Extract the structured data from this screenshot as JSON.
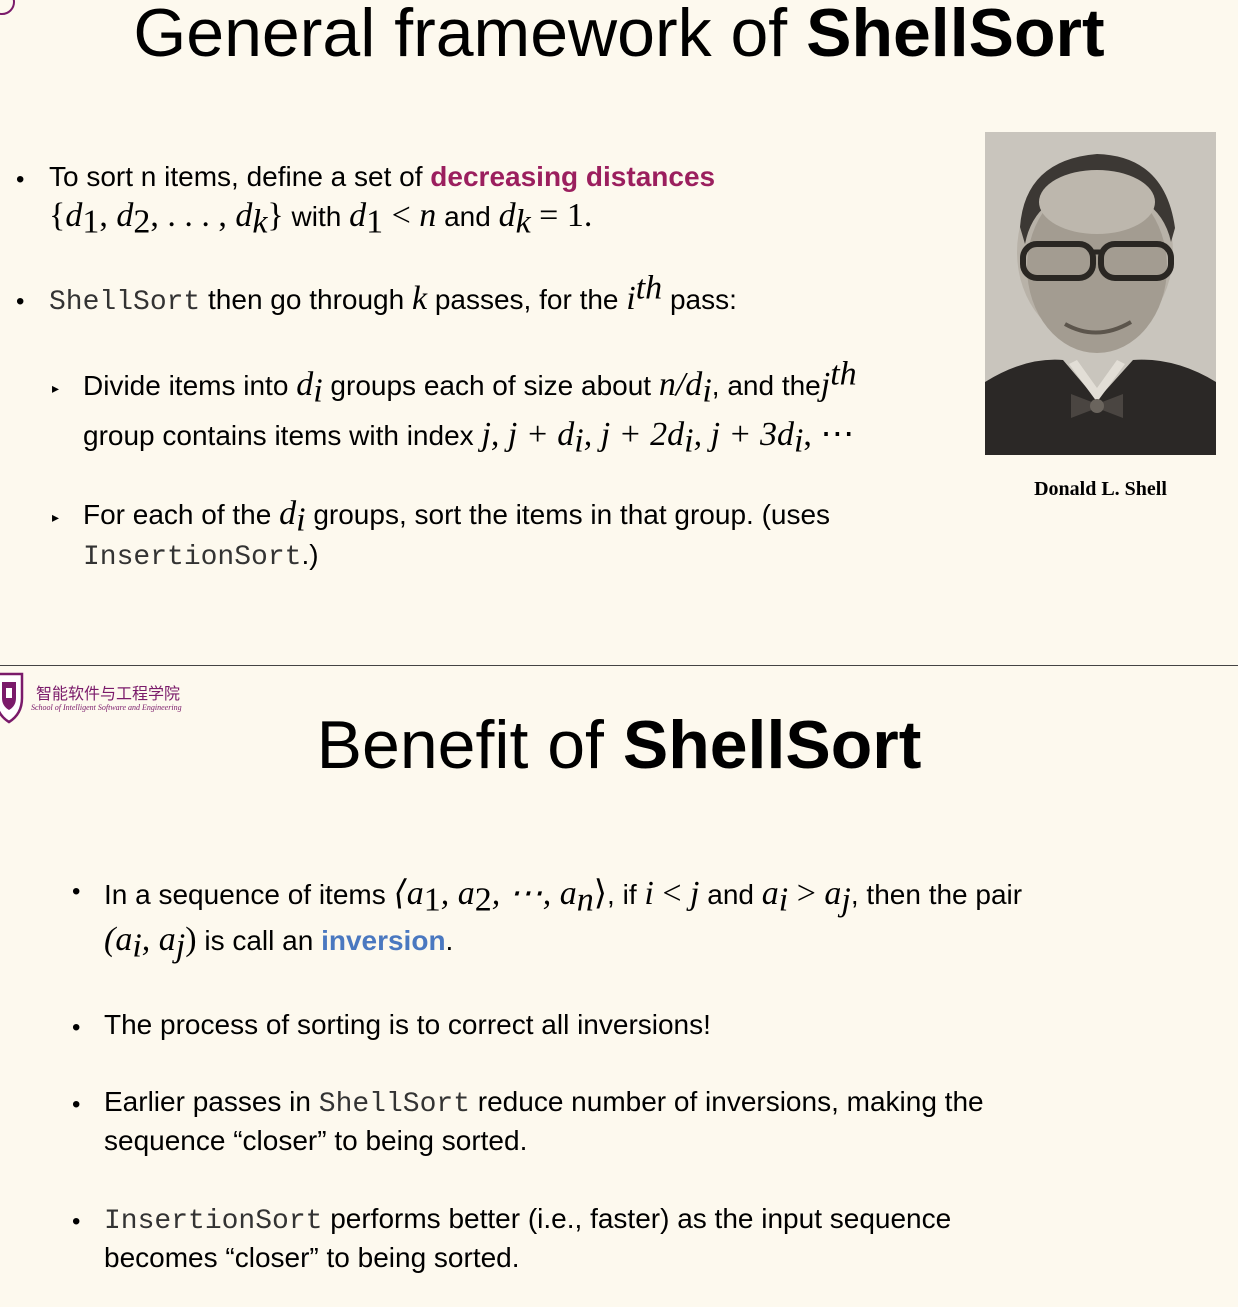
{
  "slide1": {
    "title_regular": "General framework of ",
    "title_bold": "ShellSort",
    "bullet1": {
      "text_a": "To sort n items, define a set of ",
      "highlight": "decreasing distances",
      "set_open": "{",
      "d": "d",
      "sub1": "1",
      "comma": ", ",
      "sub2": "2",
      "dots": ", . . . , ",
      "subk": "k",
      "set_close": "}",
      "with": " with ",
      "lt": " < ",
      "n": "n",
      "and": " and ",
      "eq": " = ",
      "one": "1",
      "period": "."
    },
    "bullet2": {
      "code": "ShellSort",
      "text_a": " then go through ",
      "k": "k",
      "text_b": " passes, for the ",
      "i": "i",
      "th": "th",
      "text_c": " pass:"
    },
    "sub1": {
      "text_a": "Divide items into ",
      "d": "d",
      "i": "i",
      "text_b": " groups each of size about ",
      "n_over": "n/d",
      "text_c": ", and the",
      "j": "j",
      "th": "th",
      "line2_a": "group contains items with index ",
      "expr": "j, j + d",
      "expr2": ", j + 2d",
      "expr3": ", j + 3d",
      "expr_end": ", ⋯"
    },
    "sub2": {
      "text_a": "For each of the ",
      "d": "d",
      "i": "i",
      "text_b": " groups, sort the items in that group. (uses",
      "code": "InsertionSort",
      "text_c": ".)"
    },
    "caption": "Donald L. Shell"
  },
  "slide2": {
    "logo_cn": "智能软件与工程学院",
    "logo_en": "School of Intelligent Software and Engineering",
    "title_regular": "Benefit of ",
    "title_bold": "ShellSort",
    "bullet1": {
      "text_a": "In a sequence of items ",
      "seq": "⟨a",
      "s1": "1",
      "c": ", a",
      "s2": "2",
      "mid": ", ⋯, a",
      "sn": "n",
      "close": "⟩",
      "text_b": ", if ",
      "i": "i",
      "lt": " < ",
      "j": "j",
      "and": " and ",
      "a": "a",
      "gt": " > ",
      "text_c": ", then the pair",
      "pair_open": "(a",
      "pair_c": ", a",
      "pair_close": ")",
      "text_d": " is call an ",
      "highlight": "inversion",
      "period": "."
    },
    "bullet2": "The process of sorting is to correct all inversions!",
    "bullet3": {
      "text_a": "Earlier passes in ",
      "code": "ShellSort",
      "text_b": " reduce number of inversions, making the",
      "line2": "sequence “closer” to being sorted."
    },
    "bullet4": {
      "code": "InsertionSort",
      "text_b": " performs better (i.e., faster) as the input sequence",
      "line2": "becomes “closer” to being sorted."
    }
  }
}
